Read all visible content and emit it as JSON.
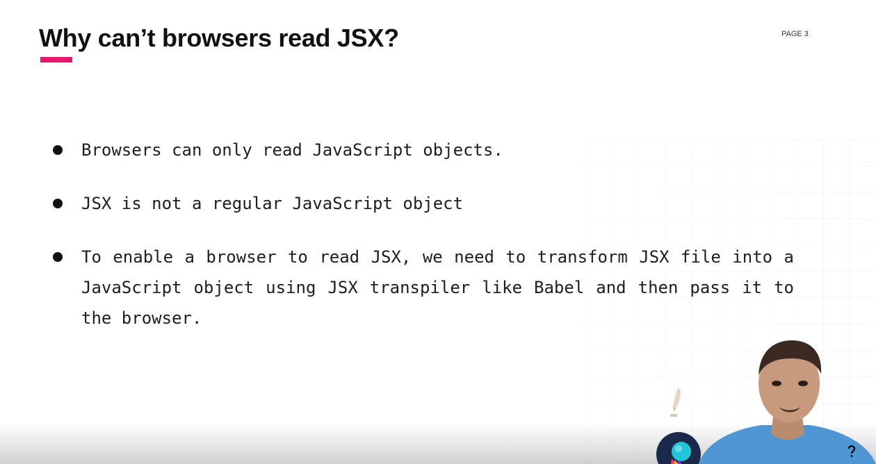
{
  "slide": {
    "title": "Why can’t browsers read JSX?",
    "page_label": "PAGE 3",
    "accent_color": "#e6196e",
    "bullets": [
      {
        "text": "Browsers can only read JavaScript objects."
      },
      {
        "text": "JSX is not a regular JavaScript object"
      },
      {
        "text": "To enable a browser to read JSX, we need to transform JSX file into a JavaScript object using JSX transpiler like Babel and then pass it to the browser."
      }
    ]
  },
  "overlay": {
    "pencil_icon": "pencil-icon",
    "logo_icon": "app-logo-icon",
    "presenter": "presenter-webcam"
  }
}
